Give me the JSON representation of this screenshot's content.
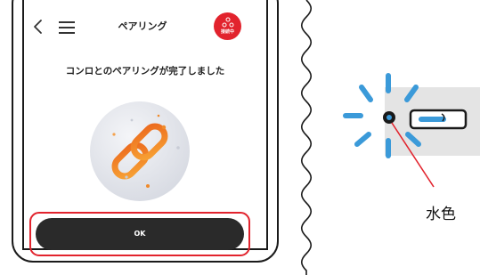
{
  "app": {
    "header": {
      "title": "ペアリング",
      "status_badge": "接続中"
    },
    "message": "コンロとのペアリングが完了しました",
    "ok_button": "OK"
  },
  "annotation": {
    "indicator_color_label": "水色"
  },
  "colors": {
    "accent_red": "#e2232d",
    "button_dark": "#2a2a2a",
    "lamp_blue": "#3b9ad9",
    "panel_gray": "#e4e4e4"
  },
  "icons": {
    "back": "chevron-left-icon",
    "menu": "hamburger-menu-icon",
    "status": "network-nodes-icon",
    "illustration": "chain-link-icon"
  }
}
